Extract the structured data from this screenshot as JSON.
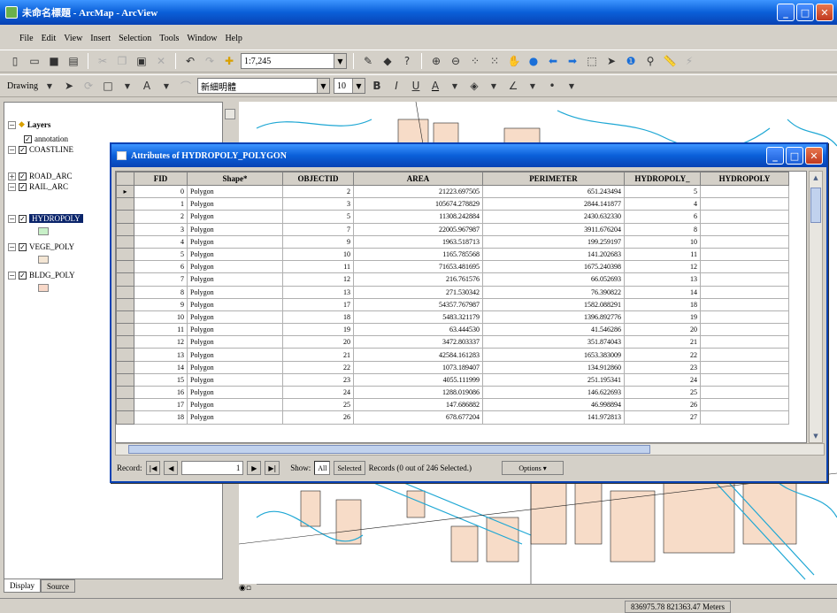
{
  "window": {
    "title": "未命名標題 - ArcMap - ArcView",
    "min": "_",
    "max": "□",
    "close": "✕"
  },
  "menu": [
    "File",
    "Edit",
    "View",
    "Insert",
    "Selection",
    "Tools",
    "Window",
    "Help"
  ],
  "toolbar": {
    "scale": "1:7,245",
    "drawing_label": "Drawing",
    "font": "新細明體",
    "font_size": "10",
    "bold": "B",
    "italic": "I",
    "underline": "U",
    "font_color": "A"
  },
  "toc": {
    "root": "Layers",
    "layers": [
      {
        "name": "annotation",
        "checked": true
      },
      {
        "name": "COASTLINE",
        "checked": true
      },
      {
        "name": "ROAD_ARC",
        "checked": true
      },
      {
        "name": "RAIL_ARC",
        "checked": true
      },
      {
        "name": "HYDROPOLY",
        "checked": true,
        "swatch": "#c8f0c8"
      },
      {
        "name": "VEGE_POLY",
        "checked": true,
        "swatch": "#f4e6d4"
      },
      {
        "name": "BLDG_POLY",
        "checked": true,
        "swatch": "#f8d8c8"
      }
    ],
    "tabs": [
      "Display",
      "Source"
    ]
  },
  "attributes": {
    "title": "Attributes of HYDROPOLY_POLYGON",
    "columns": [
      "FID",
      "Shape*",
      "OBJECTID",
      "AREA",
      "PERIMETER",
      "HYDROPOLY_",
      "HYDROPOLY"
    ],
    "rows": [
      [
        "0",
        "Polygon",
        "2",
        "21223.697505",
        "651.243494",
        "5"
      ],
      [
        "1",
        "Polygon",
        "3",
        "105674.278829",
        "2844.141877",
        "4"
      ],
      [
        "2",
        "Polygon",
        "5",
        "11308.242884",
        "2430.632330",
        "6"
      ],
      [
        "3",
        "Polygon",
        "7",
        "22005.967987",
        "3911.676204",
        "8"
      ],
      [
        "4",
        "Polygon",
        "9",
        "1963.518713",
        "199.259197",
        "10"
      ],
      [
        "5",
        "Polygon",
        "10",
        "1165.785568",
        "141.202683",
        "11"
      ],
      [
        "6",
        "Polygon",
        "11",
        "71653.481695",
        "1675.240398",
        "12"
      ],
      [
        "7",
        "Polygon",
        "12",
        "216.761576",
        "66.052693",
        "13"
      ],
      [
        "8",
        "Polygon",
        "13",
        "271.530342",
        "76.390822",
        "14"
      ],
      [
        "9",
        "Polygon",
        "17",
        "54357.767987",
        "1582.088291",
        "18"
      ],
      [
        "10",
        "Polygon",
        "18",
        "5483.321179",
        "1396.892776",
        "19"
      ],
      [
        "11",
        "Polygon",
        "19",
        "63.444530",
        "41.546286",
        "20"
      ],
      [
        "12",
        "Polygon",
        "20",
        "3472.803337",
        "351.874043",
        "21"
      ],
      [
        "13",
        "Polygon",
        "21",
        "42584.161283",
        "1653.383009",
        "22"
      ],
      [
        "14",
        "Polygon",
        "22",
        "1073.189407",
        "134.912860",
        "23"
      ],
      [
        "15",
        "Polygon",
        "23",
        "4055.111999",
        "251.195341",
        "24"
      ],
      [
        "16",
        "Polygon",
        "24",
        "1288.019086",
        "146.622693",
        "25"
      ],
      [
        "17",
        "Polygon",
        "25",
        "147.686882",
        "46.998894",
        "26"
      ],
      [
        "18",
        "Polygon",
        "26",
        "678.677204",
        "141.972813",
        "27"
      ]
    ],
    "nav": {
      "record_label": "Record:",
      "record_value": "1",
      "show_label": "Show:",
      "all": "All",
      "selected": "Selected",
      "records_text": "Records (0 out of 246 Selected.)",
      "options": "Options"
    }
  },
  "status": {
    "coords": "836975.78  821363.47 Meters"
  }
}
